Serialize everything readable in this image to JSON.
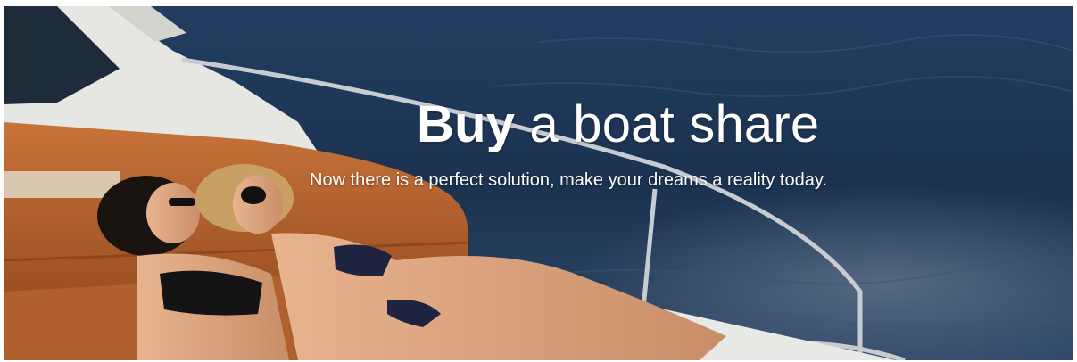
{
  "hero": {
    "headline_bold": "Buy",
    "headline_rest": " a boat share",
    "subheadline": "Now there is a perfect solution, make your dreams a reality today.",
    "image_subject": "two-women-sunbathing-on-boat-deck-photo"
  },
  "colors": {
    "sea": "#1f3a5c",
    "leather": "#b8632e",
    "hull": "#e9e9e6",
    "text": "#ffffff"
  }
}
